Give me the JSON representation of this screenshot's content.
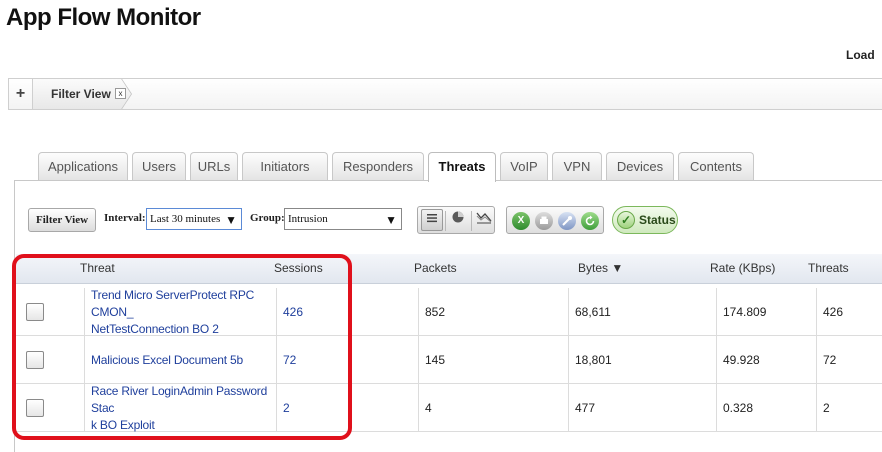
{
  "page": {
    "title": "App Flow Monitor",
    "load_label": "Load"
  },
  "filter_bar": {
    "add_symbol": "+",
    "crumb_label": "Filter View",
    "crumb_close": "x"
  },
  "tabs": [
    {
      "label": "Applications",
      "active": false
    },
    {
      "label": "Users",
      "active": false
    },
    {
      "label": "URLs",
      "active": false
    },
    {
      "label": "Initiators",
      "active": false
    },
    {
      "label": "Responders",
      "active": false
    },
    {
      "label": "Threats",
      "active": true
    },
    {
      "label": "VoIP",
      "active": false
    },
    {
      "label": "VPN",
      "active": false
    },
    {
      "label": "Devices",
      "active": false
    },
    {
      "label": "Contents",
      "active": false
    }
  ],
  "toolbar": {
    "filter_view_label": "Filter View",
    "interval_label": "Interval:",
    "interval_value": "Last 30 minutes",
    "group_label": "Group:",
    "group_value": "Intrusion",
    "dropdown_arrow": "▼",
    "status_label": "Status",
    "status_check": "✓",
    "view_icons": [
      "list-view-icon",
      "pie-chart-icon",
      "line-chart-icon"
    ],
    "action_icons": [
      "excel-export-icon",
      "print-icon",
      "settings-icon",
      "refresh-icon"
    ]
  },
  "grid": {
    "columns": [
      "Threat",
      "Sessions",
      "Packets",
      "Bytes ▼",
      "Rate (KBps)",
      "Threats"
    ],
    "rows": [
      {
        "threat_line1": "Trend Micro ServerProtect RPC CMON_",
        "threat_line2": "NetTestConnection BO 2",
        "sessions": "426",
        "packets": "852",
        "bytes": "68,611",
        "rate": "174.809",
        "threats": "426"
      },
      {
        "threat_line1": "Malicious Excel Document 5b",
        "threat_line2": "",
        "sessions": "72",
        "packets": "145",
        "bytes": "18,801",
        "rate": "49.928",
        "threats": "72"
      },
      {
        "threat_line1": "Race River LoginAdmin Password Stac",
        "threat_line2": "k BO Exploit",
        "sessions": "2",
        "packets": "4",
        "bytes": "477",
        "rate": "0.328",
        "threats": "2"
      }
    ]
  },
  "colors": {
    "highlight": "#e0101b",
    "link": "#1f3f9c",
    "status_green": "#7cb85c"
  }
}
